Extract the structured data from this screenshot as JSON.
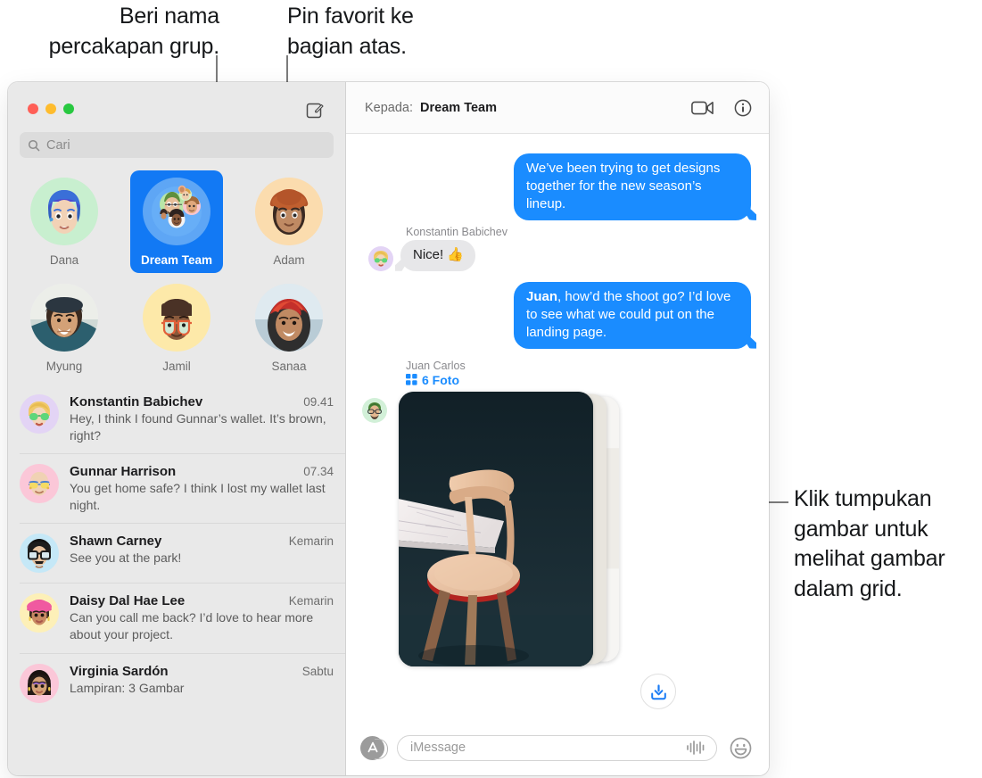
{
  "callouts": [
    {
      "id": "name-group",
      "text": "Beri nama percakapan grup."
    },
    {
      "id": "pin-favorites",
      "text": "Pin favorit ke bagian atas."
    },
    {
      "id": "click-stack",
      "text": "Klik tumpukan gambar untuk melihat gambar dalam grid."
    }
  ],
  "window": {
    "traffic_lights": {
      "close": "close-red",
      "minimize": "minimize-yellow",
      "zoom": "zoom-green"
    },
    "compose_tooltip": "Tulis Pesan Baru"
  },
  "sidebar": {
    "search": {
      "placeholder": "Cari",
      "value": "",
      "icon": "search-icon"
    },
    "pinned": [
      {
        "name": "Dana",
        "selected": false,
        "bg": "#c8efcf"
      },
      {
        "name": "Dream Team",
        "selected": true,
        "bg": "#5ea6f5"
      },
      {
        "name": "Adam",
        "selected": false,
        "bg": "#fbdcae"
      },
      {
        "name": "Myung",
        "selected": false,
        "bg": "#f2f2f2"
      },
      {
        "name": "Jamil",
        "selected": false,
        "bg": "#fde9a9"
      },
      {
        "name": "Sanaa",
        "selected": false,
        "bg": "#dfe6ea"
      }
    ],
    "conversations": [
      {
        "name": "Konstantin Babichev",
        "time": "09.41",
        "preview": "Hey, I think I found Gunnar’s wallet. It’s brown, right?",
        "avatar_bg": "#e3d4f5"
      },
      {
        "name": "Gunnar Harrison",
        "time": "07.34",
        "preview": "You get home safe? I think I lost my wallet last night.",
        "avatar_bg": "#fbc7d8"
      },
      {
        "name": "Shawn Carney",
        "time": "Kemarin",
        "preview": "See you at the park!",
        "avatar_bg": "#c5e8f7"
      },
      {
        "name": "Daisy Dal Hae Lee",
        "time": "Kemarin",
        "preview": "Can you call me back? I’d love to hear more about your project.",
        "avatar_bg": "#fdf0b8"
      },
      {
        "name": "Virginia Sardón",
        "time": "Sabtu",
        "preview": "Lampiran: 3 Gambar",
        "avatar_bg": "#fbc7d8"
      }
    ]
  },
  "conversation": {
    "to_label": "Kepada:",
    "to_value": "Dream Team",
    "facetime_icon": "video-camera-icon",
    "info_icon": "info-circle-icon",
    "messages": [
      {
        "type": "text",
        "direction": "outgoing",
        "text": "We’ve been trying to get designs together for the new season’s lineup."
      },
      {
        "type": "text",
        "direction": "incoming",
        "sender": "Konstantin Babichev",
        "text": "Nice! 👍"
      },
      {
        "type": "text",
        "direction": "outgoing",
        "bold_prefix": "Juan",
        "text": ", how’d the shoot go? I’d love to see what we could put on the landing page."
      },
      {
        "type": "photo-stack",
        "direction": "incoming",
        "sender": "Juan Carlos",
        "count_label": "6 Foto",
        "grid_icon": "grid-icon",
        "save_icon": "download-icon"
      }
    ]
  },
  "composer": {
    "apps_icon": "app-store-icon",
    "input_placeholder": "iMessage",
    "input_value": "",
    "audio_icon": "audio-waveform-icon",
    "emoji_icon": "smiley-face-icon"
  },
  "colors": {
    "accent_blue": "#1a8cff",
    "selected_blue": "#1279f4",
    "incoming_gray": "#e7e7e9",
    "sidebar_bg": "#e9e9e9"
  }
}
